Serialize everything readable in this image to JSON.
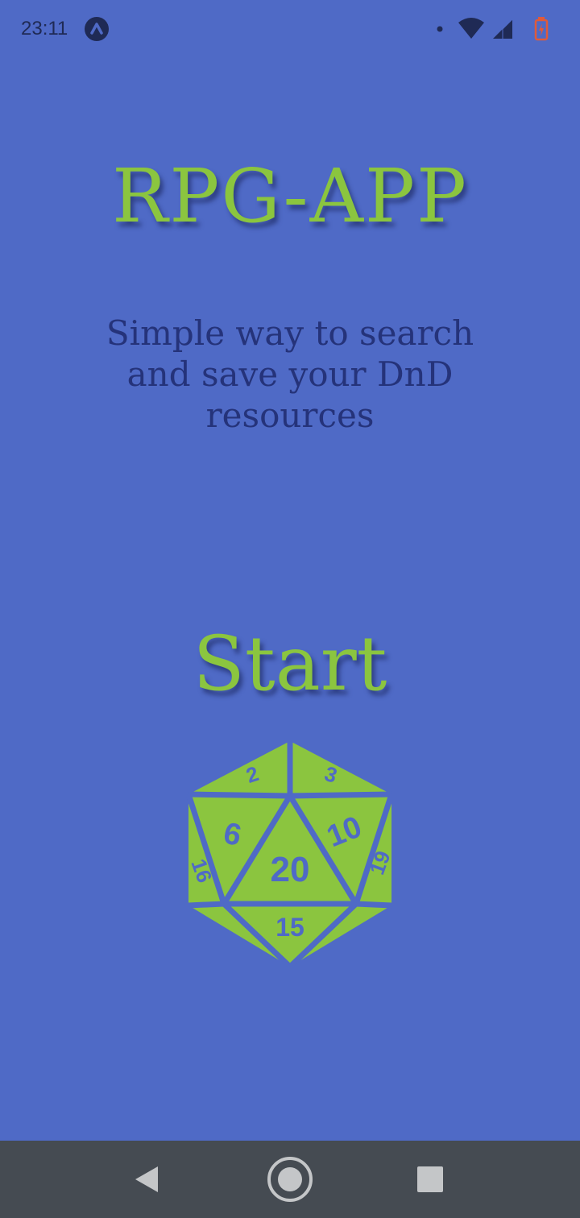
{
  "status_bar": {
    "time": "23:11",
    "icons": [
      "app-notification-icon",
      "dot-icon",
      "wifi-icon",
      "signal-icon",
      "battery-charging-icon"
    ]
  },
  "main": {
    "title": "RPG-APP",
    "subtitle": "Simple way to search and save your DnD resources",
    "start_label": "Start",
    "dice_icon": "d20-dice-icon",
    "dice_faces": [
      "2",
      "3",
      "6",
      "10",
      "20",
      "16",
      "19",
      "15"
    ]
  },
  "nav_bar": {
    "icons": [
      "back-icon",
      "home-icon",
      "recents-icon"
    ]
  },
  "colors": {
    "background": "#4f6ac6",
    "accent_green": "#8bc53f",
    "subtitle_text": "#25337a",
    "nav_bar": "#454b52"
  }
}
